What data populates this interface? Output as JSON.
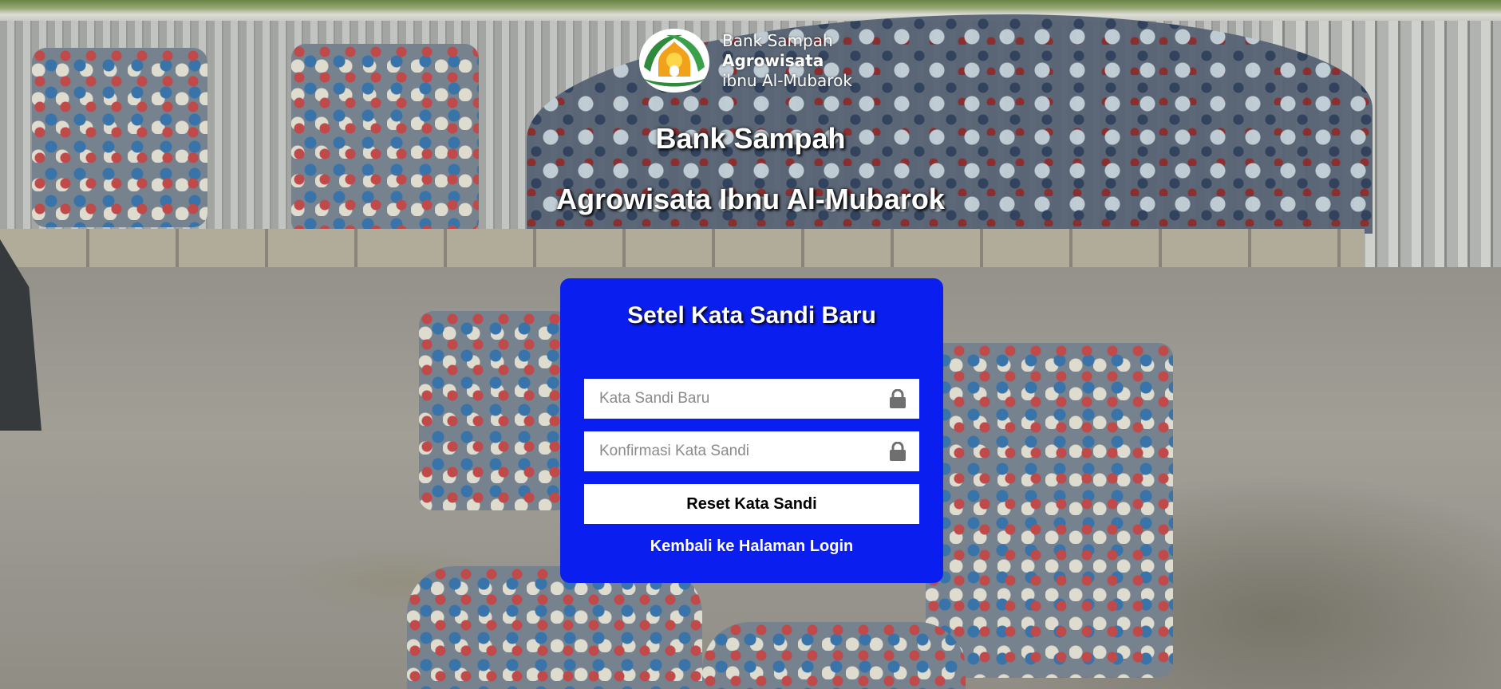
{
  "logo": {
    "line1": "Bank Sampah",
    "line2": "Agrowisata",
    "line3": "ibnu Al-Mubarok",
    "icon": "mosque-leaf-logo",
    "colors": {
      "leaf": "#2f8a3c",
      "dome": "#f2a21a"
    }
  },
  "hero": {
    "title": "Bank Sampah",
    "subtitle": "Agrowisata Ibnu Al-Mubarok"
  },
  "card": {
    "title": "Setel Kata Sandi Baru",
    "new_password": {
      "placeholder": "Kata Sandi Baru",
      "value": "",
      "icon": "lock-icon"
    },
    "confirm_password": {
      "placeholder": "Konfirmasi Kata Sandi",
      "value": "",
      "icon": "lock-icon"
    },
    "submit_label": "Reset Kata Sandi",
    "back_link_label": "Kembali ke Halaman Login",
    "background_color": "#0a1fef"
  }
}
